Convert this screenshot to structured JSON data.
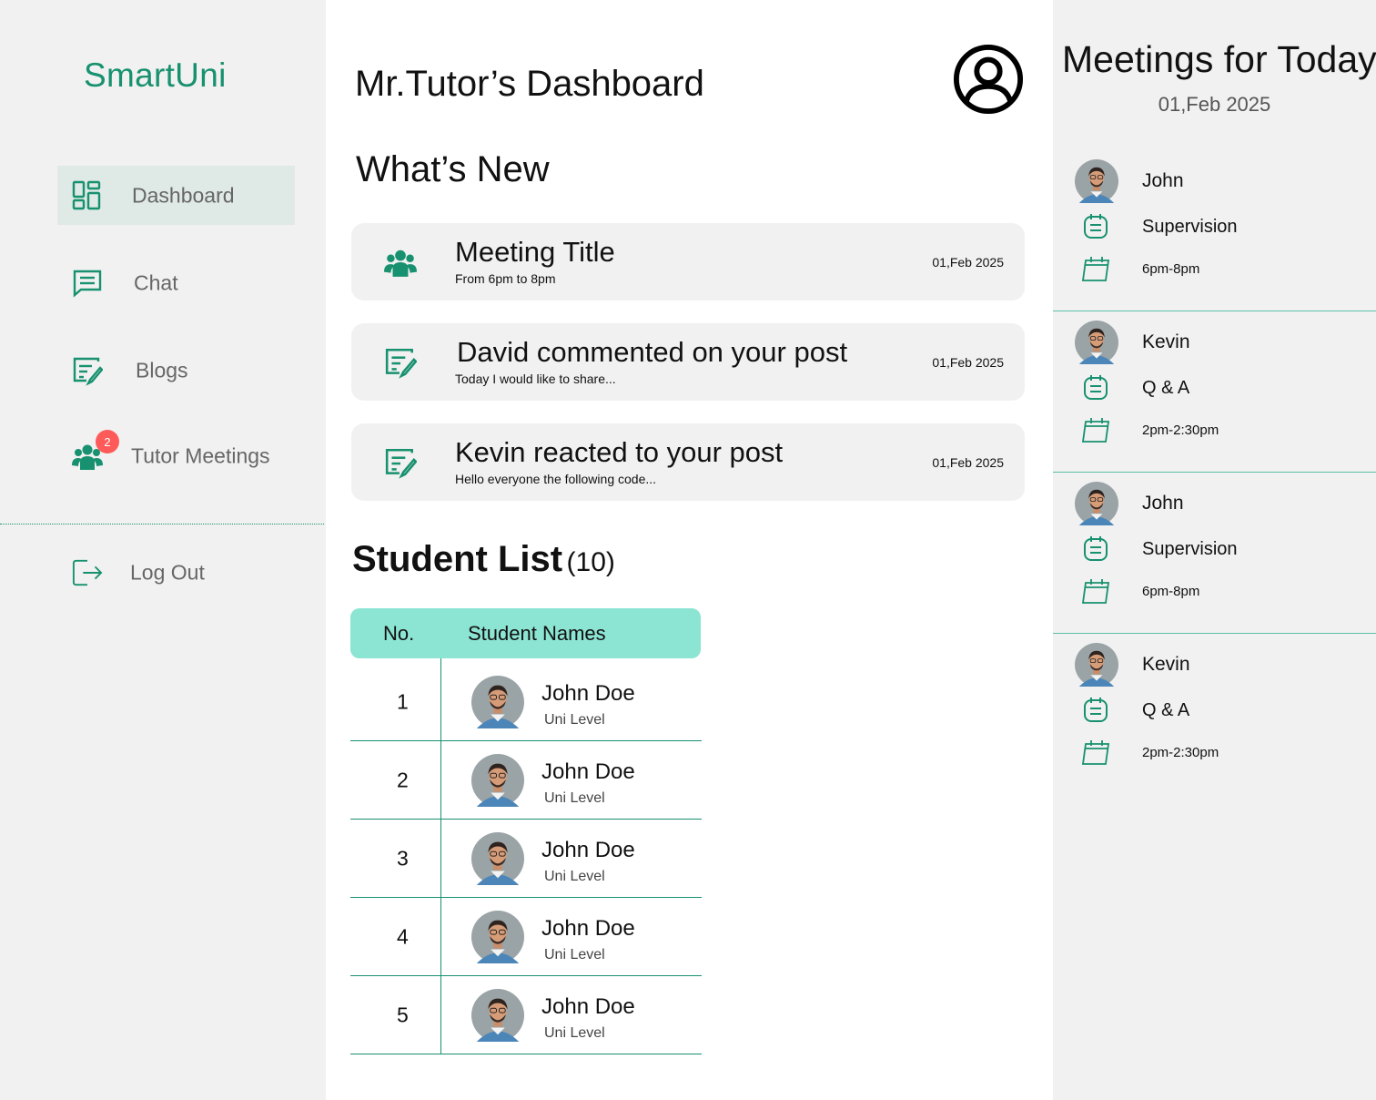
{
  "brand": "SmartUni",
  "colors": {
    "accent": "#17916f",
    "table_header": "#8ce4d3",
    "badge": "#ff5a5a",
    "active_nav": "#dfe9e5"
  },
  "sidebar": {
    "items": [
      {
        "label": "Dashboard",
        "icon": "dashboard-icon",
        "active": true
      },
      {
        "label": "Chat",
        "icon": "chat-icon"
      },
      {
        "label": "Blogs",
        "icon": "blog-edit-icon"
      },
      {
        "label": "Tutor Meetings",
        "icon": "users-group-icon",
        "badge": "2"
      }
    ],
    "logout": {
      "label": "Log Out",
      "icon": "logout-icon"
    }
  },
  "main": {
    "title": "Mr.Tutor’s Dashboard",
    "whats_new_heading": "What’s New",
    "cards": [
      {
        "icon": "users-group-icon",
        "title": "Meeting Title",
        "subtitle": "From 6pm to 8pm",
        "date": "01,Feb 2025"
      },
      {
        "icon": "blog-edit-icon",
        "title": "David commented on your post",
        "subtitle": "Today I would like to share...",
        "date": "01,Feb 2025"
      },
      {
        "icon": "blog-edit-icon",
        "title": "Kevin reacted to your post",
        "subtitle": "Hello everyone the following code...",
        "date": "01,Feb 2025"
      }
    ],
    "student_list": {
      "heading": "Student List",
      "count": "(10)",
      "columns": [
        "No.",
        "Student Names"
      ],
      "rows": [
        {
          "no": "1",
          "name": "John Doe",
          "level": "Uni Level"
        },
        {
          "no": "2",
          "name": "John Doe",
          "level": "Uni Level"
        },
        {
          "no": "3",
          "name": "John Doe",
          "level": "Uni Level"
        },
        {
          "no": "4",
          "name": "John Doe",
          "level": "Uni Level"
        },
        {
          "no": "5",
          "name": "John Doe",
          "level": "Uni Level"
        }
      ]
    }
  },
  "right_panel": {
    "title": "Meetings for Today",
    "date": "01,Feb 2025",
    "meetings": [
      {
        "name": "John",
        "type": "Supervision",
        "time": "6pm-8pm"
      },
      {
        "name": "Kevin",
        "type": "Q & A",
        "time": "2pm-2:30pm"
      },
      {
        "name": "John",
        "type": "Supervision",
        "time": "6pm-8pm"
      },
      {
        "name": "Kevin",
        "type": "Q & A",
        "time": "2pm-2:30pm"
      }
    ]
  }
}
